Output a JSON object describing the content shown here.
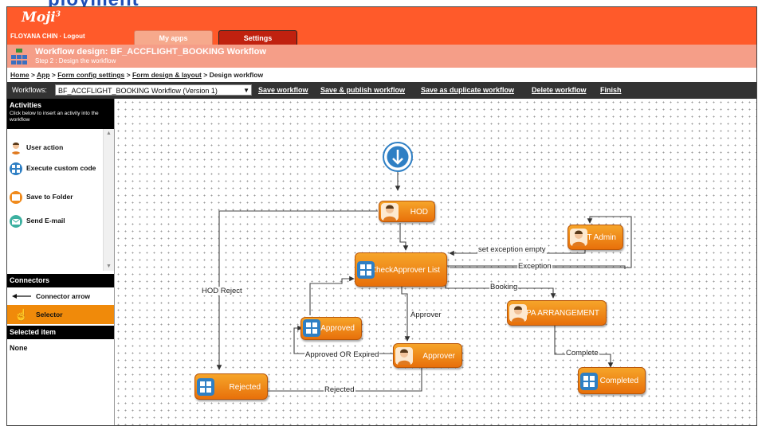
{
  "app": {
    "logo": "Moji",
    "logo_sup": "3",
    "user": "FLOYANA CHIN",
    "logout": "Logout"
  },
  "tabs": [
    {
      "label": "My apps"
    },
    {
      "label": "Settings"
    }
  ],
  "design": {
    "title": "Workflow design: BF_ACCFLIGHT_BOOKING Workflow",
    "step": "Step 2 : Design the workflow"
  },
  "breadcrumb": {
    "home": "Home",
    "app": "App",
    "form_config": "Form config settings",
    "form_design": "Form design & layout",
    "current": "Design workflow"
  },
  "toolbar": {
    "workflows_label": "Workflows:",
    "selected": "BF_ACCFLIGHT_BOOKING Workflow (Version 1)",
    "save": "Save workflow",
    "save_publish": "Save & publish workflow",
    "save_duplicate": "Save as duplicate workflow",
    "delete": "Delete workflow",
    "finish": "Finish"
  },
  "sidebar": {
    "activities_title": "Activities",
    "activities_hint": "Click below to insert an activity into the workflow",
    "activities": [
      {
        "label": "User action",
        "icon": "user-icon"
      },
      {
        "label": "Execute custom code",
        "icon": "code-icon"
      },
      {
        "label": "Save to Folder",
        "icon": "folder-icon"
      },
      {
        "label": "Send E-mail",
        "icon": "email-icon"
      }
    ],
    "connectors_title": "Connectors",
    "connector_arrow": "Connector arrow",
    "selector": "Selector",
    "selected_title": "Selected item",
    "selected_value": "None"
  },
  "workflow": {
    "nodes": {
      "hod": "HOD",
      "check_approver": "CheckApprover List",
      "it_admin": "IT Admin",
      "pa_arrangement": "PA ARRANGEMENT",
      "approved": "Approved",
      "approver": "Approver",
      "rejected": "Rejected",
      "completed": "Completed"
    },
    "edges": {
      "hod_reject": "HOD Reject",
      "set_exception_empty": "set exception empty",
      "exception": "Exception",
      "booking": "Booking",
      "approver": "Approver",
      "approved_or_expired": "Approved OR Expired",
      "rejected": "Rejected",
      "complete": "Complete"
    }
  },
  "colors": {
    "topbar": "#ff5a2a",
    "node_orange": "#f08a1c",
    "header_pink": "#f59e88",
    "settings_tab": "#c0210f"
  }
}
